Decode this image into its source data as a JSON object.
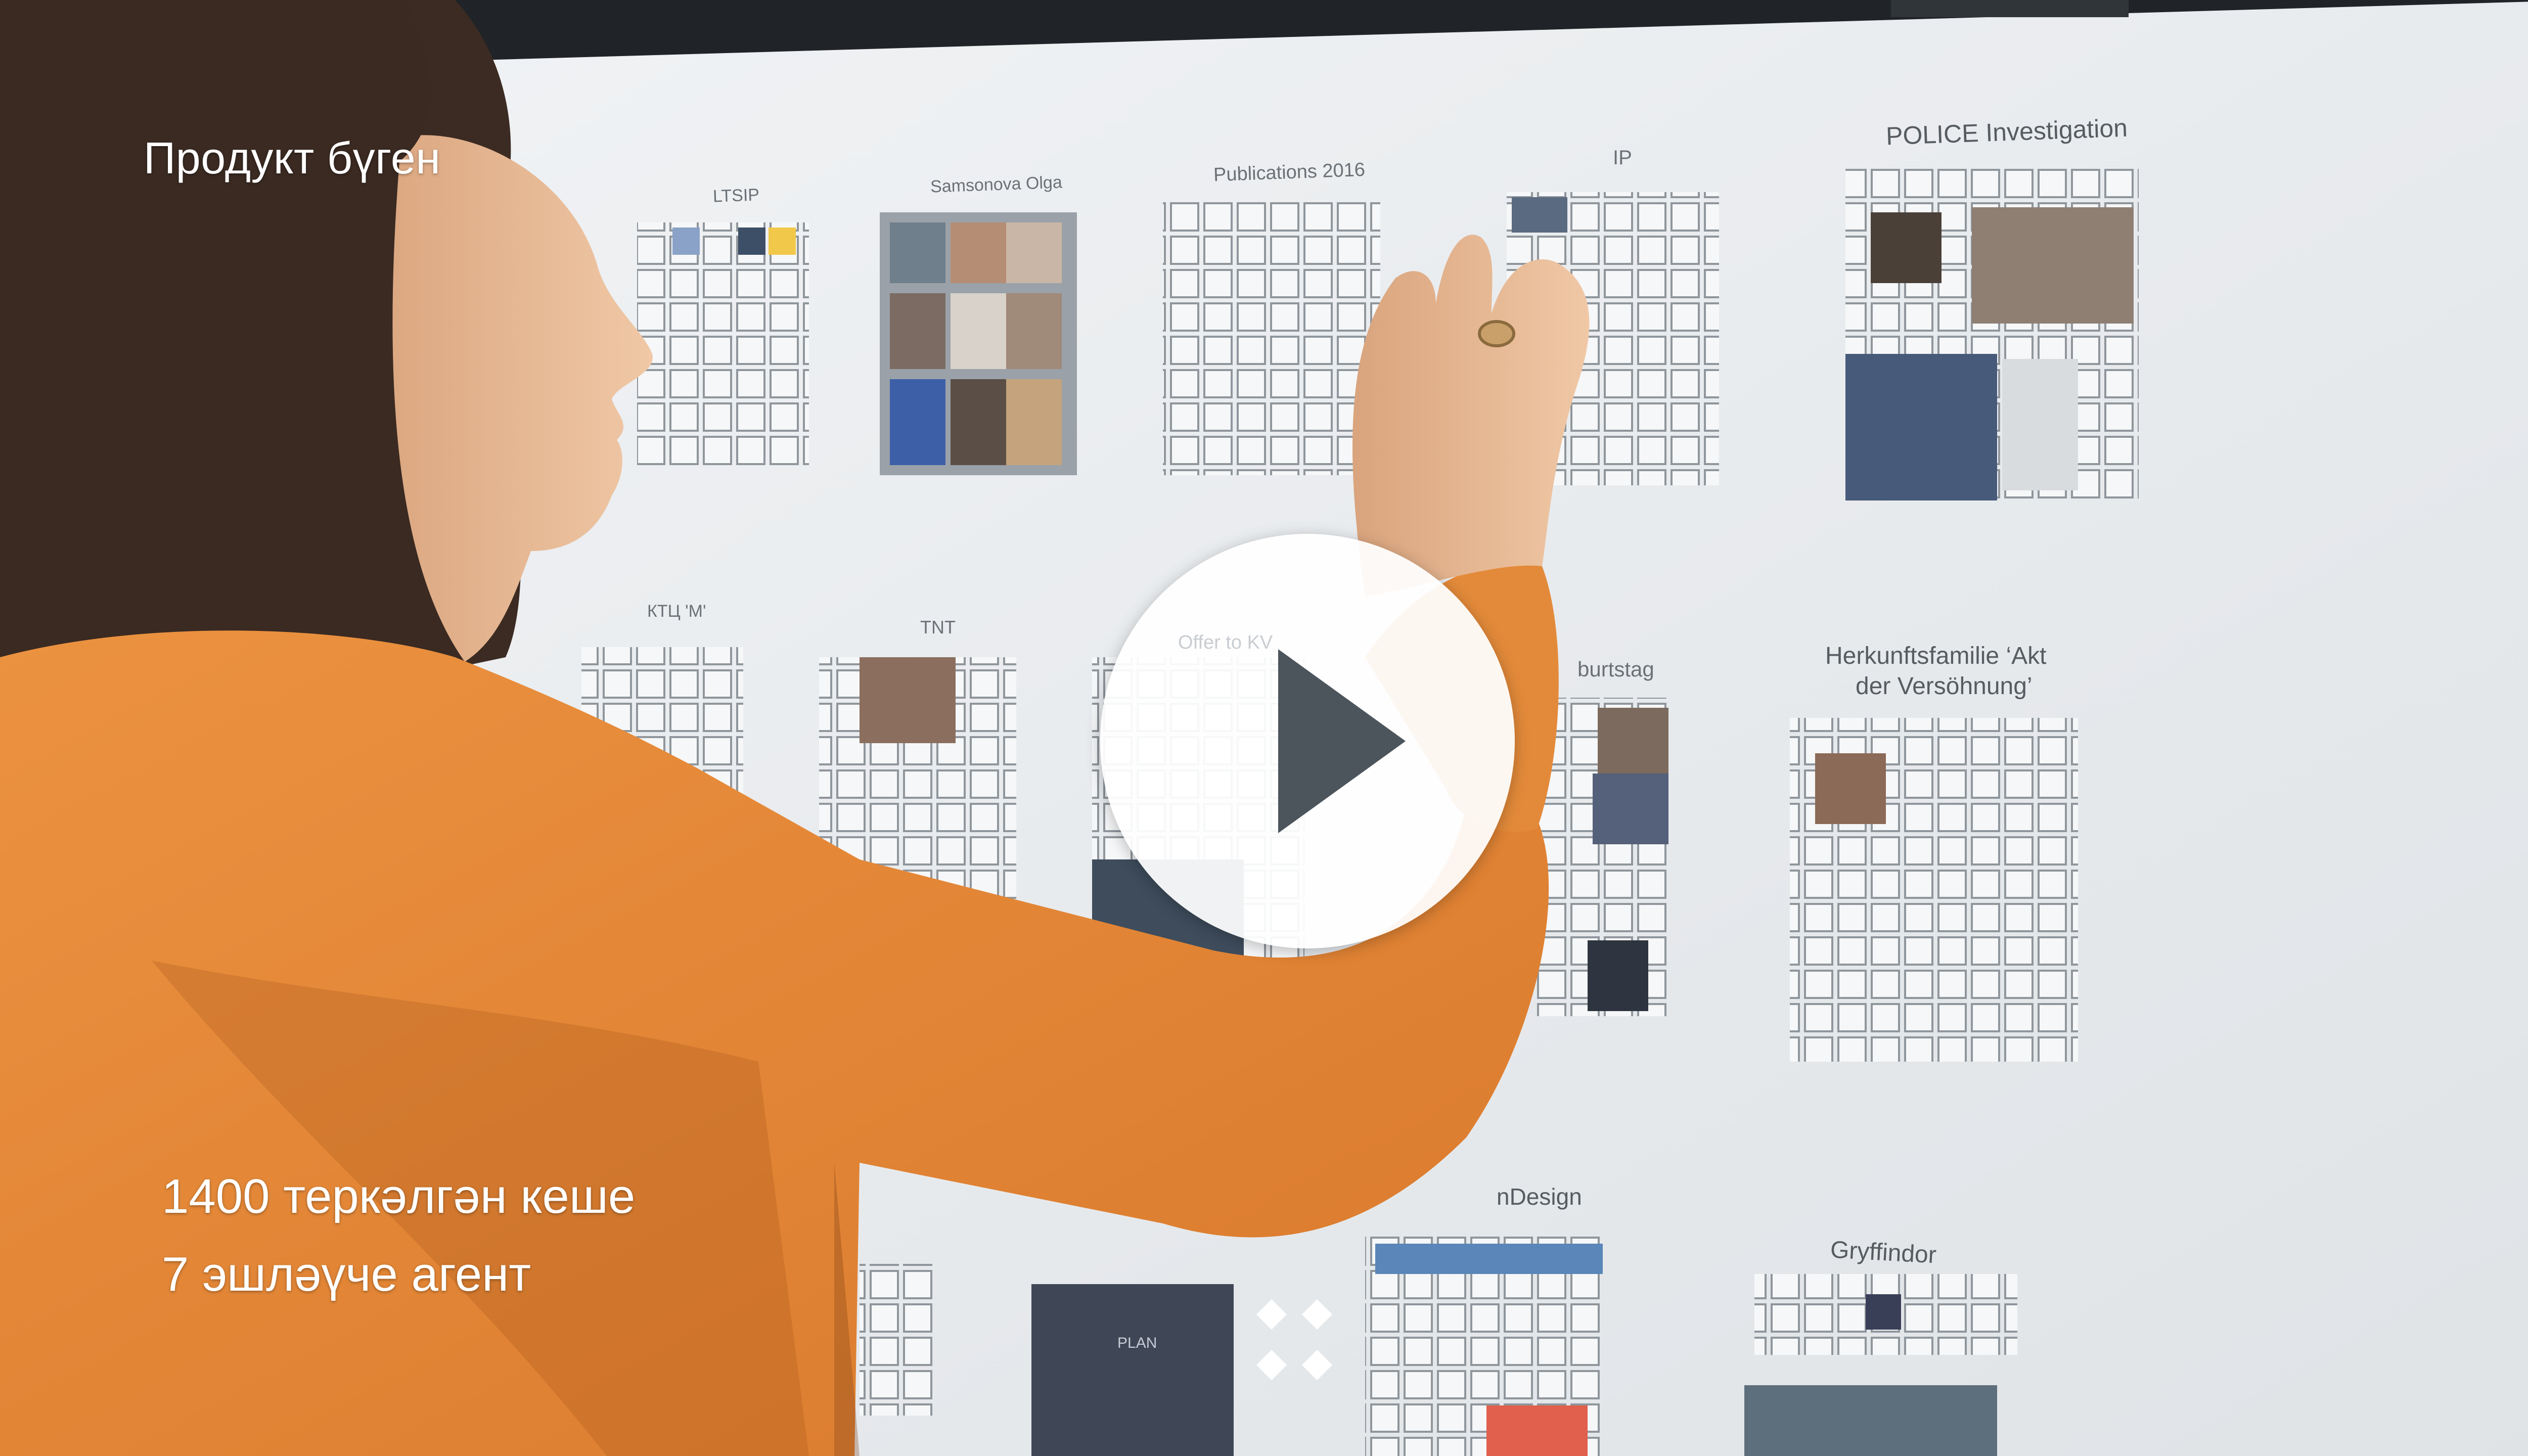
{
  "overlay": {
    "title": "Продукт бүген",
    "stats": [
      "1400 теркәлгән кеше",
      "7 эшләүче агент"
    ]
  },
  "screen_labels": {
    "ltsip": "LTSIP",
    "samsonova": "Samsonova Olga",
    "publications": "Publications 2016",
    "ip": "IP",
    "police": "POLICE Investigation",
    "ktc": "КТЦ 'M'",
    "tnt": "TNT",
    "offer": "Offer to KV",
    "geburtstag": "burtstag",
    "herkunft_1": "Herkunftsfamilie ‘Akt",
    "herkunft_2": "der Versöhnung’",
    "design": "nDesign",
    "gryffindor": "Gryffindor",
    "plan": "PLAN"
  },
  "icons": {
    "play": "play-icon",
    "nav": "diamond-grid-icon"
  },
  "colors": {
    "screen_bg": "#e9ecef",
    "shirt": "#e58a37",
    "hair": "#3a2a22",
    "skin": "#e7b893",
    "overlay_text": "#ffffff",
    "play_bg": "#ffffff",
    "play_triangle": "#4c545c"
  }
}
